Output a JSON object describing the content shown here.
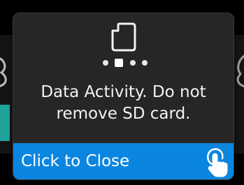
{
  "popup": {
    "message_line1": "Data Activity. Do not",
    "message_line2": "remove SD card.",
    "close_label": "Click to Close",
    "icons": {
      "top": "sd-card-icon",
      "progress": "activity-dots-icon",
      "close": "touch-hand-icon"
    },
    "activity_dots": 4,
    "active_dot_index": 1
  },
  "colors": {
    "popup_background": "#262626",
    "close_bar": "#0b86e0",
    "text": "#f2f2f2",
    "background_accent": "#1fa39a"
  }
}
